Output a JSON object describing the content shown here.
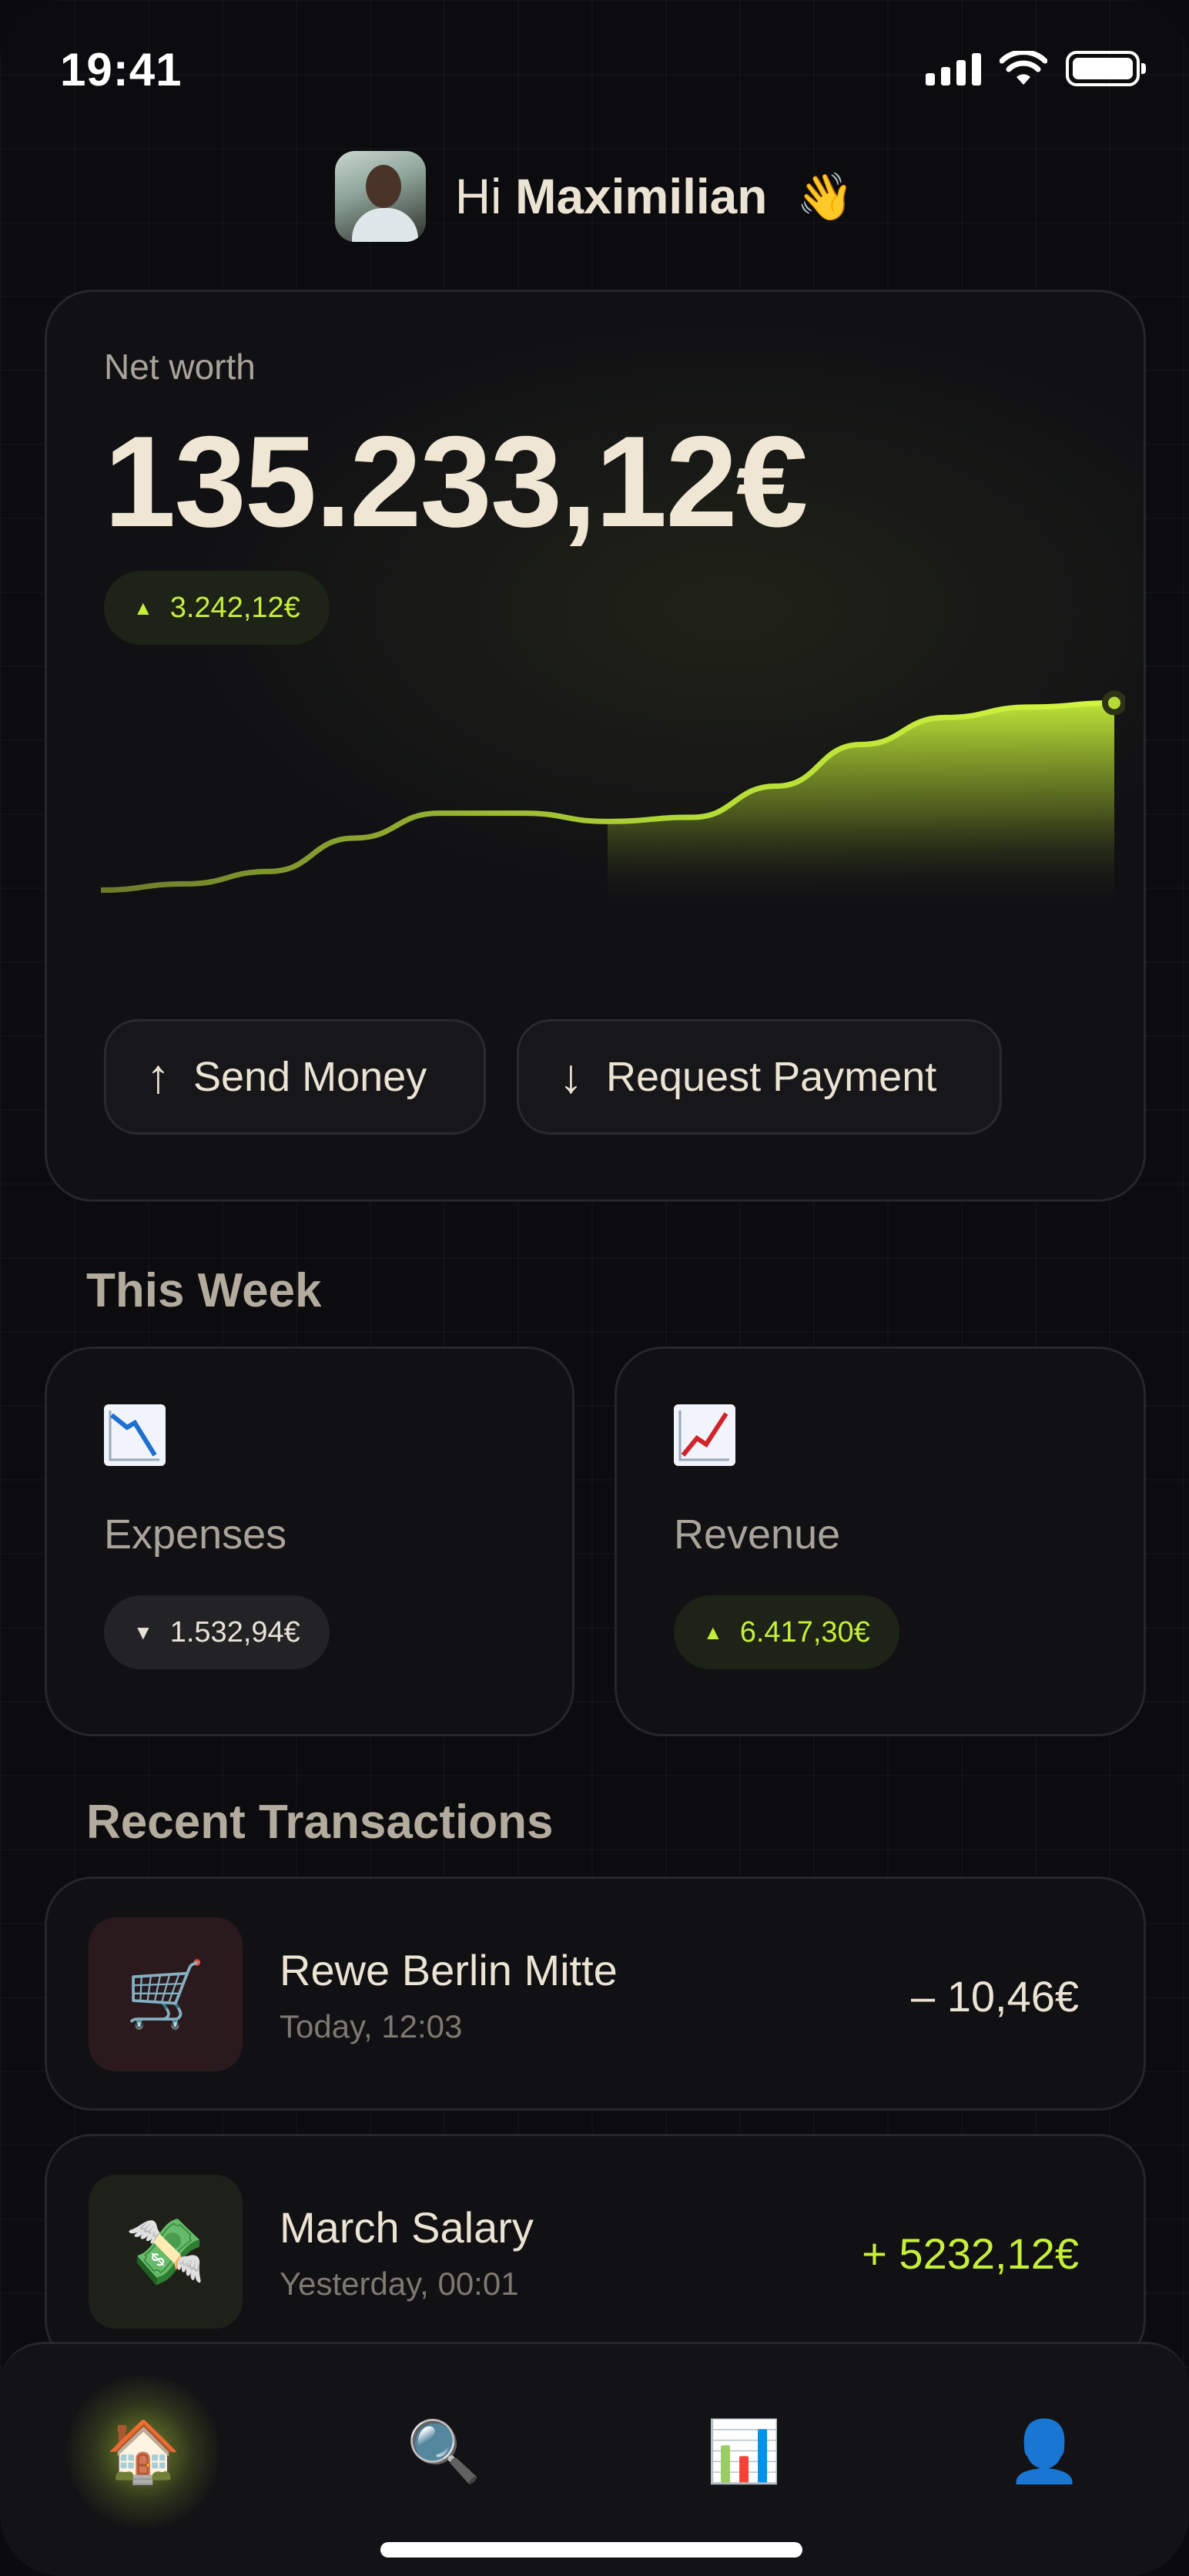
{
  "status_bar": {
    "time": "19:41"
  },
  "greeting": {
    "prefix": "Hi",
    "name": "Maximilian",
    "emoji": "👋"
  },
  "net_worth": {
    "label": "Net worth",
    "value": "135.233,12€",
    "change": "3.242,12€",
    "change_direction": "up",
    "trend": [
      0.05,
      0.08,
      0.14,
      0.3,
      0.42,
      0.42,
      0.38,
      0.4,
      0.55,
      0.75,
      0.88,
      0.93,
      0.95
    ],
    "accent_color": "#c6ef3a"
  },
  "actions": {
    "send": "Send Money",
    "request": "Request Payment"
  },
  "this_week": {
    "title": "This Week",
    "expenses": {
      "label": "Expenses",
      "icon": "chart-decreasing-icon",
      "value": "1.532,94€",
      "direction": "down"
    },
    "revenue": {
      "label": "Revenue",
      "icon": "chart-increasing-icon",
      "value": "6.417,30€",
      "direction": "up"
    }
  },
  "recent": {
    "title": "Recent Transactions",
    "items": [
      {
        "name": "Rewe Berlin Mitte",
        "time": "Today, 12:03",
        "amount": "– 10,46€",
        "icon": "shopping-cart-icon",
        "color": "#ebe3d3"
      },
      {
        "name": "March Salary",
        "time": "Yesterday, 00:01",
        "amount": "+ 5232,12€",
        "icon": "money-with-wings-icon",
        "color": "#c6ef3a"
      }
    ]
  },
  "tabbar": {
    "items": [
      "home-icon",
      "search-icon",
      "stats-icon",
      "profile-icon"
    ],
    "active": "home-icon"
  }
}
